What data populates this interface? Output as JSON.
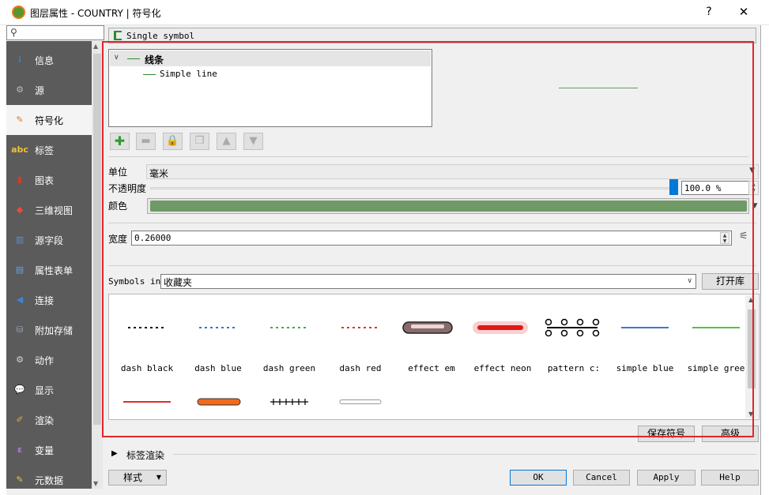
{
  "window": {
    "title": "图层属性 - COUNTRY | 符号化",
    "help_label": "?",
    "close_label": "✕"
  },
  "search": {
    "placeholder": "",
    "icon": "search-icon"
  },
  "sidebar": {
    "items": [
      {
        "label": "信息",
        "icon": "info-icon",
        "glyph": "i",
        "color": "#3a7cc9"
      },
      {
        "label": "源",
        "icon": "wrench-icon",
        "glyph": "⚙",
        "color": "#bbbbbb"
      },
      {
        "label": "符号化",
        "icon": "paintbrush-icon",
        "glyph": "✎",
        "color": "#d97a2b"
      },
      {
        "label": "标签",
        "icon": "abc-label-icon",
        "glyph": "abc",
        "color": "#f1c232"
      },
      {
        "label": "图表",
        "icon": "diagram-icon",
        "glyph": "▮",
        "color": "#d33a2c"
      },
      {
        "label": "三维视图",
        "icon": "cube-3d-icon",
        "glyph": "◆",
        "color": "#e84b3c"
      },
      {
        "label": "源字段",
        "icon": "fields-icon",
        "glyph": "▥",
        "color": "#5b8fd6"
      },
      {
        "label": "属性表单",
        "icon": "form-icon",
        "glyph": "▤",
        "color": "#6aa0e0"
      },
      {
        "label": "连接",
        "icon": "join-icon",
        "glyph": "◀",
        "color": "#3d84d8"
      },
      {
        "label": "附加存储",
        "icon": "database-icon",
        "glyph": "⛁",
        "color": "#9aa5b2"
      },
      {
        "label": "动作",
        "icon": "gear-icon",
        "glyph": "⚙",
        "color": "#cfd5dc"
      },
      {
        "label": "显示",
        "icon": "speech-bubble-icon",
        "glyph": "💬",
        "color": "#f5d94a"
      },
      {
        "label": "渲染",
        "icon": "brush-icon",
        "glyph": "✐",
        "color": "#e5a534"
      },
      {
        "label": "变量",
        "icon": "epsilon-icon",
        "glyph": "ε",
        "color": "#b27ad9"
      },
      {
        "label": "元数据",
        "icon": "metadata-icon",
        "glyph": "✎",
        "color": "#e0c24e"
      }
    ],
    "selected_index": 2
  },
  "renderer": {
    "value": "Single symbol"
  },
  "symbol_tree": {
    "root_label": "线条",
    "child_label": "Simple line"
  },
  "toolbar": {
    "add_icon": "add-layer-icon",
    "remove_icon": "remove-layer-icon",
    "lock_icon": "lock-icon",
    "duplicate_icon": "duplicate-icon",
    "up_icon": "move-up-icon",
    "down_icon": "move-down-icon"
  },
  "properties": {
    "unit_label": "单位",
    "unit_value": "毫米",
    "opacity_label": "不透明度",
    "opacity_value": "100.0 %",
    "opacity_fraction": 1.0,
    "color_label": "颜色",
    "color_value": "#6f9a65",
    "width_label": "宽度",
    "width_value": "0.26000"
  },
  "library": {
    "symbols_in_label": "Symbols in",
    "group_value": "收藏夹",
    "open_library_label": "打开库",
    "save_symbol_label": "保存符号",
    "advanced_label": "高级",
    "symbols": [
      {
        "name": "dash  black",
        "kind": "dash",
        "color": "#000000"
      },
      {
        "name": "dash blue",
        "kind": "dash",
        "color": "#3b6fcf"
      },
      {
        "name": "dash green",
        "kind": "dash",
        "color": "#3fae3f"
      },
      {
        "name": "dash red",
        "kind": "dash",
        "color": "#e03030"
      },
      {
        "name": "effect em",
        "kind": "emboss",
        "color": "#6b3b3b"
      },
      {
        "name": "effect neon",
        "kind": "neon",
        "color": "#e01818"
      },
      {
        "name": "pattern c:",
        "kind": "pattern",
        "color": "#000000"
      },
      {
        "name": "simple blue",
        "kind": "solid",
        "color": "#3d7ac9"
      },
      {
        "name": "simple gree",
        "kind": "solid",
        "color": "#5bbf3a"
      },
      {
        "name": "",
        "kind": "solid",
        "color": "#e02a2a"
      },
      {
        "name": "",
        "kind": "thick",
        "color": "#f26a1b"
      },
      {
        "name": "",
        "kind": "railway",
        "color": "#000000"
      },
      {
        "name": "",
        "kind": "outline",
        "color": "#999999"
      }
    ]
  },
  "label_rendering": {
    "label": "标签渲染"
  },
  "footer": {
    "style_label": "样式",
    "ok_label": "OK",
    "cancel_label": "Cancel",
    "apply_label": "Apply",
    "help_label": "Help"
  }
}
